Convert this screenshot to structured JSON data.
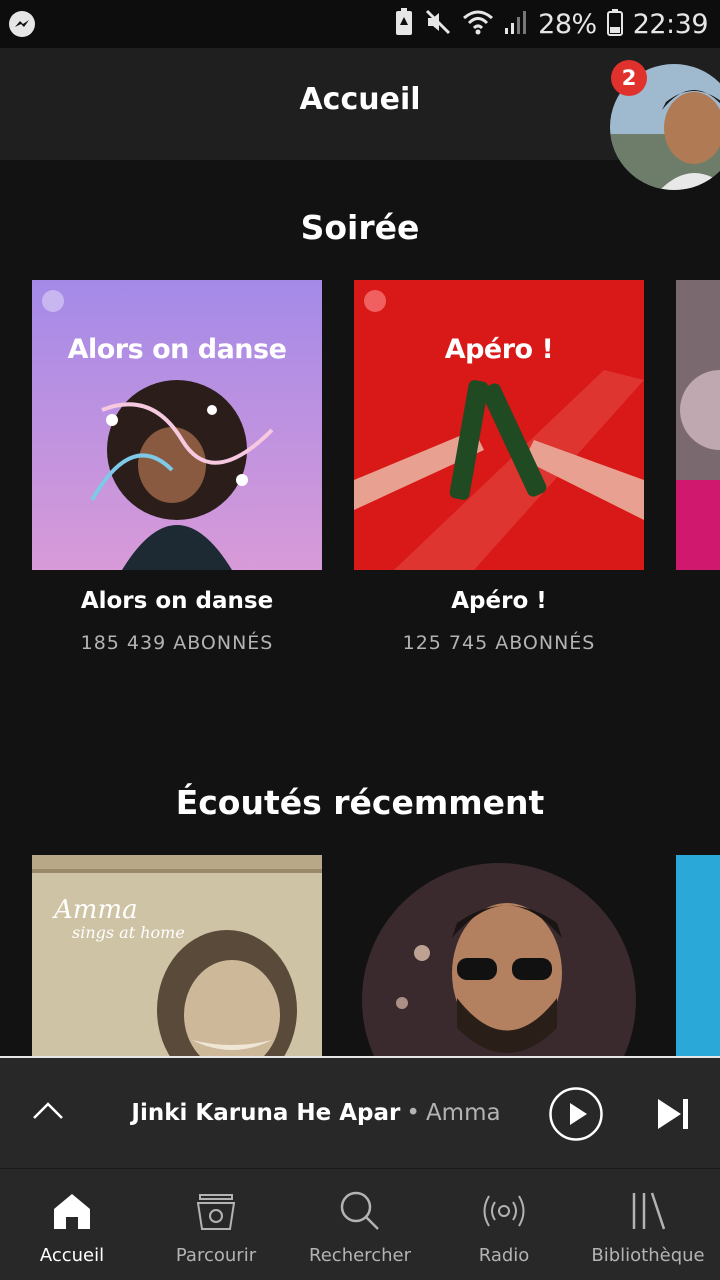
{
  "status_bar": {
    "battery_percent": "28%",
    "time": "22:39",
    "icons": [
      "messenger-icon",
      "battery-saver-icon",
      "mute-icon",
      "wifi-icon",
      "signal-icon",
      "battery-icon"
    ]
  },
  "header": {
    "title": "Accueil",
    "notification_count": "2"
  },
  "sections": [
    {
      "title": "Soirée",
      "items": [
        {
          "cover_text": "Alors on danse",
          "title": "Alors on danse",
          "subtitle": "185 439 ABONNÉS",
          "color": "#b08be6"
        },
        {
          "cover_text": "Apéro !",
          "title": "Apéro !",
          "subtitle": "125 745 ABONNÉS",
          "color": "#d91818"
        }
      ]
    },
    {
      "title": "Écoutés récemment",
      "items": [
        {
          "cover_text_line1": "Amma",
          "cover_text_line2": "sings at home",
          "color": "#cfc3a6"
        },
        {
          "shape": "circle",
          "color": "#3a2a2e"
        }
      ]
    }
  ],
  "player": {
    "track": "Jinki Karuna He Apar",
    "separator": "•",
    "artist": "Amma",
    "icons": [
      "chevron-up-icon",
      "play-icon",
      "skip-next-icon"
    ]
  },
  "nav": [
    {
      "label": "Accueil",
      "icon": "home-icon",
      "active": true
    },
    {
      "label": "Parcourir",
      "icon": "browse-icon",
      "active": false
    },
    {
      "label": "Rechercher",
      "icon": "search-icon",
      "active": false
    },
    {
      "label": "Radio",
      "icon": "radio-icon",
      "active": false
    },
    {
      "label": "Bibliothèque",
      "icon": "library-icon",
      "active": false
    }
  ],
  "colors": {
    "background": "#121212",
    "bar": "#282828",
    "badge": "#e0312c",
    "text_secondary": "#b3b3b3"
  }
}
